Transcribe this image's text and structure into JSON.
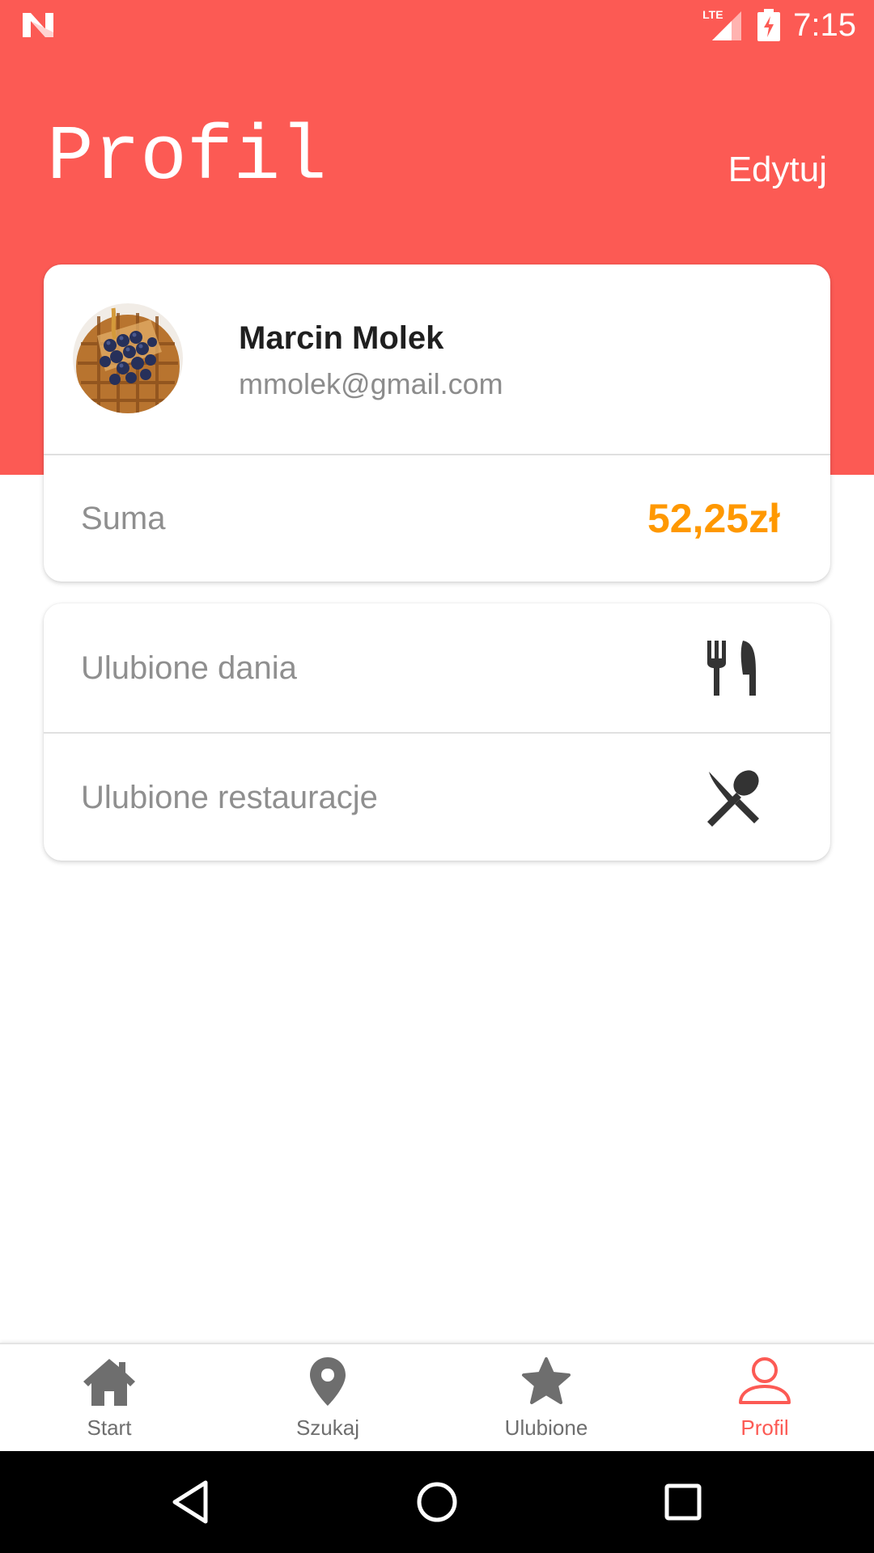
{
  "status_bar": {
    "time": "7:15",
    "network_label": "LTE",
    "icons": [
      "notification-n-icon",
      "lte-signal-icon",
      "battery-charging-icon"
    ]
  },
  "header": {
    "title": "Profil",
    "edit_label": "Edytuj"
  },
  "profile": {
    "name": "Marcin Molek",
    "email": "mmolek@gmail.com",
    "avatar": "waffle-blueberries-avatar"
  },
  "summary": {
    "label": "Suma",
    "value": "52,25zł"
  },
  "favorites": [
    {
      "label": "Ulubione dania",
      "icon": "fork-knife-icon"
    },
    {
      "label": "Ulubione restauracje",
      "icon": "crossed-spoon-knife-icon"
    }
  ],
  "bottom_nav": {
    "items": [
      {
        "label": "Start",
        "icon": "home-icon",
        "active": false
      },
      {
        "label": "Szukaj",
        "icon": "location-pin-icon",
        "active": false
      },
      {
        "label": "Ulubione",
        "icon": "star-icon",
        "active": false
      },
      {
        "label": "Profil",
        "icon": "person-icon",
        "active": true
      }
    ]
  },
  "system_nav": [
    "back-icon",
    "home-circle-icon",
    "recents-icon"
  ],
  "colors": {
    "accent": "#fc5a54",
    "sum_value": "#ff9800",
    "muted_text": "#8f8f8f",
    "nav_inactive": "#6e6e6e"
  }
}
